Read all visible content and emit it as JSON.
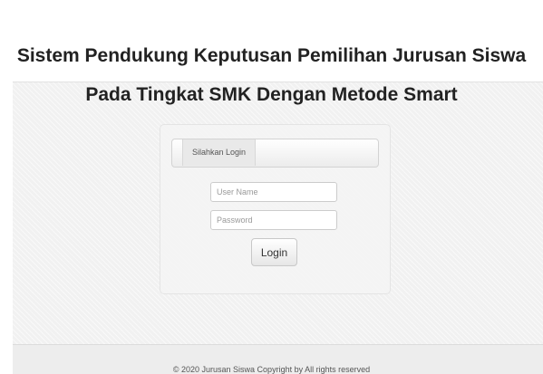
{
  "header": {
    "title_line_1": "Sistem Pendukung Keputusan Pemilihan Jurusan Siswa",
    "title_line_2": "Pada Tingkat SMK Dengan Metode Smart"
  },
  "login": {
    "tab_label": "Silahkan Login",
    "username_placeholder": "User Name",
    "password_placeholder": "Password",
    "button_label": "Login"
  },
  "footer": {
    "text": "© 2020 Jurusan Siswa   Copyright by      All rights reserved"
  }
}
